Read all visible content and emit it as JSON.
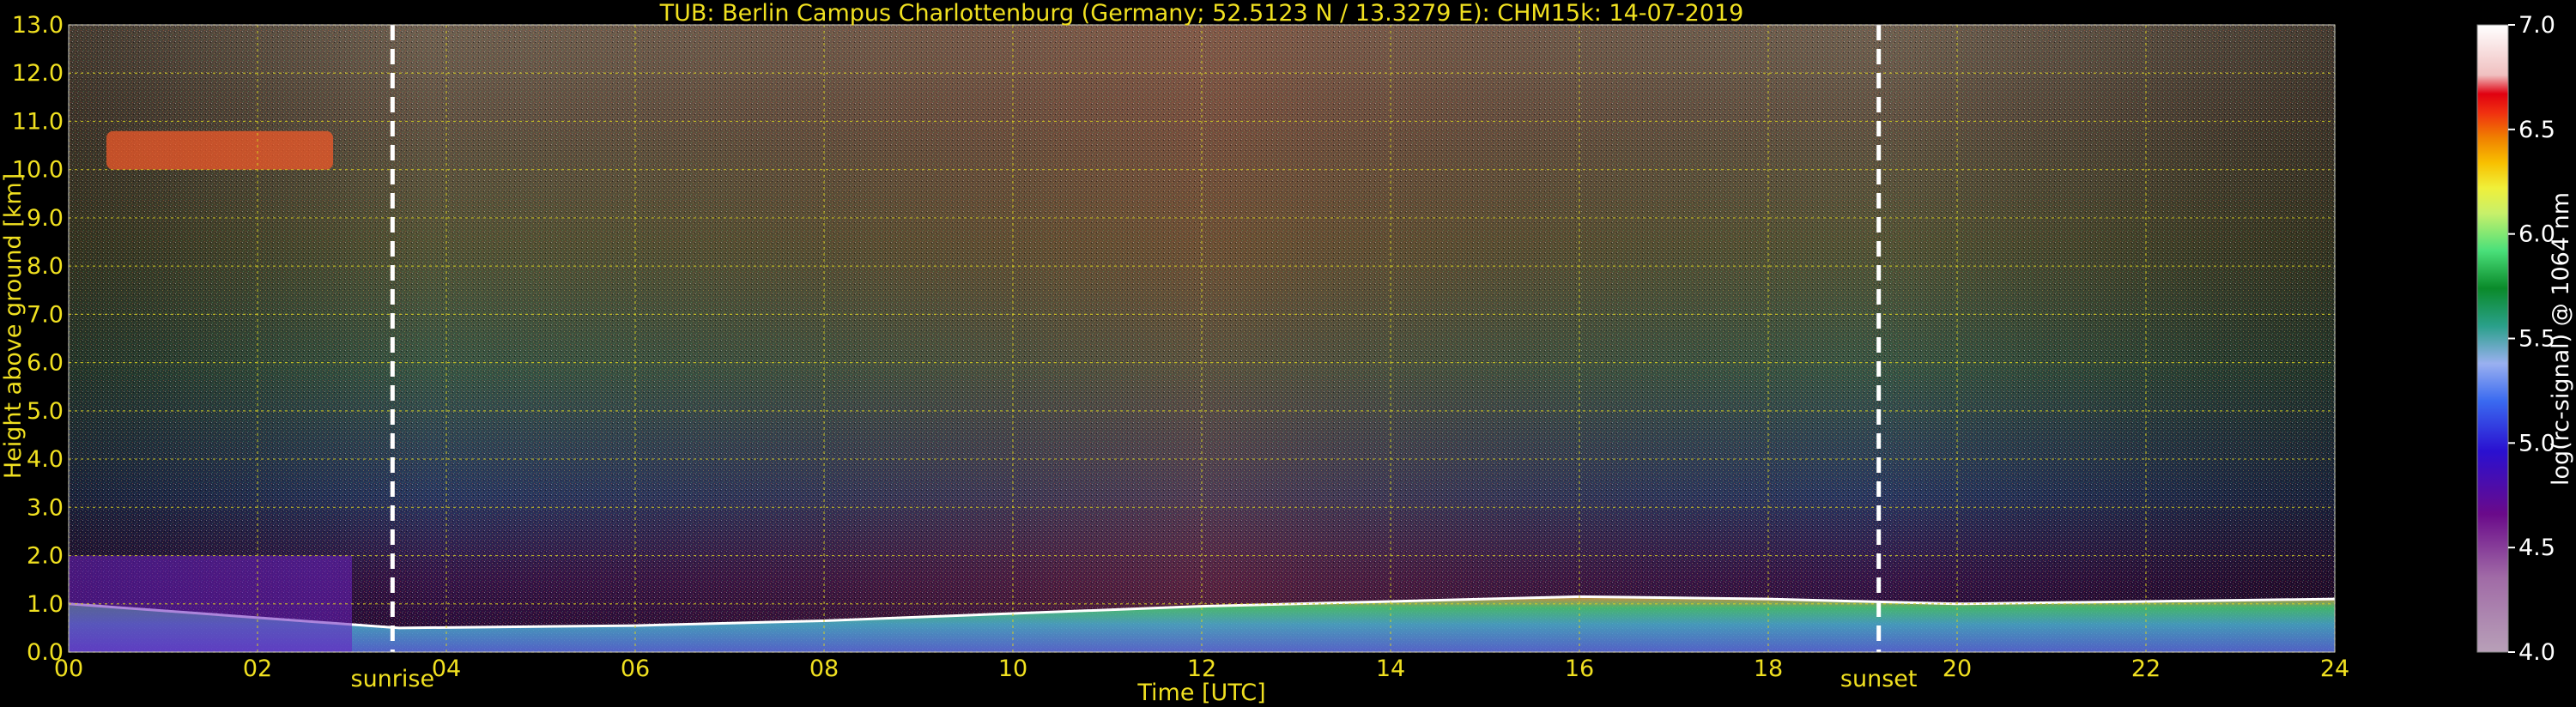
{
  "chart_data": {
    "type": "heatmap",
    "title": "TUB: Berlin Campus Charlottenburg (Germany; 52.5123 N / 13.3279 E):    CHM15k: 14-07-2019",
    "xlabel": "Time [UTC]",
    "ylabel": "Height above ground [km]",
    "x_range": [
      0,
      24
    ],
    "y_range": [
      0,
      13
    ],
    "x_ticks": [
      "00",
      "02",
      "04",
      "06",
      "08",
      "10",
      "12",
      "14",
      "16",
      "18",
      "20",
      "22",
      "24"
    ],
    "y_ticks": [
      "0.0",
      "1.0",
      "2.0",
      "3.0",
      "4.0",
      "5.0",
      "6.0",
      "7.0",
      "8.0",
      "9.0",
      "10.0",
      "11.0",
      "12.0",
      "13.0"
    ],
    "grid": true,
    "colorbar": {
      "label": "log(rc-signal) @ 1064 nm",
      "range": [
        4.0,
        7.0
      ],
      "ticks": [
        "4.0",
        "4.5",
        "5.0",
        "5.5",
        "6.0",
        "6.5",
        "7.0"
      ]
    },
    "markers": [
      {
        "label": "sunrise",
        "time_utc": 3.43
      },
      {
        "label": "sunset",
        "time_utc": 19.17
      }
    ],
    "boundary_layer_top_km": [
      [
        0,
        1.0
      ],
      [
        3.5,
        0.5
      ],
      [
        6,
        0.55
      ],
      [
        8,
        0.65
      ],
      [
        10,
        0.8
      ],
      [
        12,
        0.95
      ],
      [
        14,
        1.05
      ],
      [
        16,
        1.15
      ],
      [
        18,
        1.1
      ],
      [
        20,
        1.0
      ],
      [
        22,
        1.05
      ],
      [
        24,
        1.1
      ]
    ],
    "cirrus_layer": {
      "time_start": 0.4,
      "time_end": 2.8,
      "height_km": [
        10.0,
        10.8
      ]
    }
  }
}
